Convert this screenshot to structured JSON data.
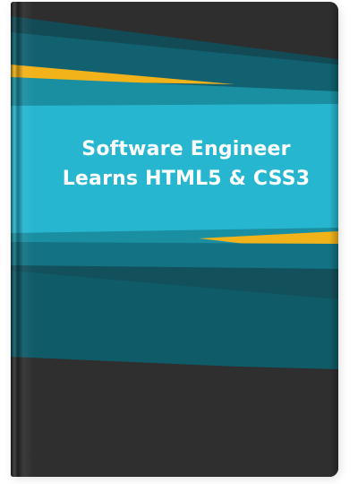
{
  "cover": {
    "title_line_1": "Software Engineer",
    "title_line_2": "Learns HTML5 & CSS3"
  },
  "colors": {
    "dark_base": "#2e2e2e",
    "dark_teal": "#124a56",
    "mid_teal": "#0f6d7c",
    "light_teal": "#1a8fa2",
    "cyan_band": "#27b6d0",
    "accent_yellow": "#f2b31a",
    "title_text": "#ffffff"
  }
}
